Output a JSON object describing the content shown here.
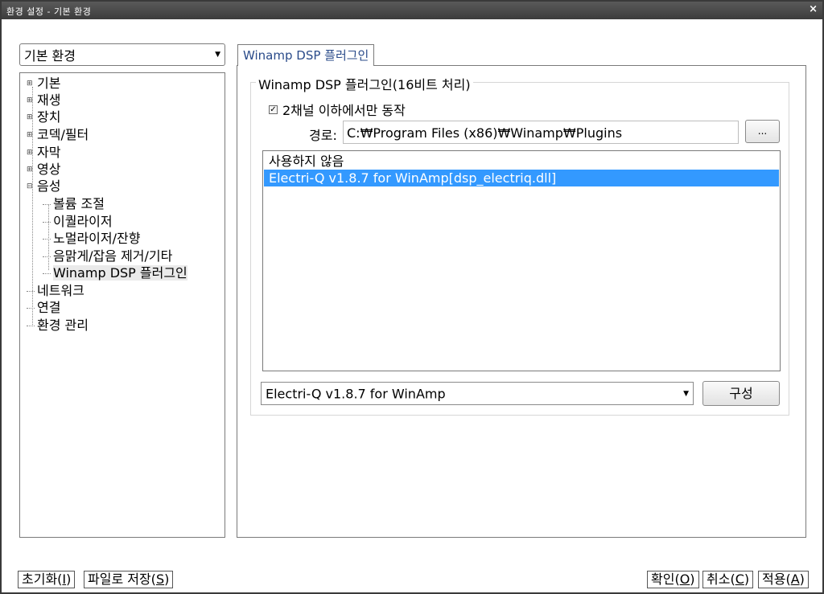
{
  "window": {
    "title": "환경 설정 - 기본 환경",
    "close_glyph": "×"
  },
  "category_combo": {
    "value": "기본 환경"
  },
  "tree": {
    "items": [
      {
        "label": "기본"
      },
      {
        "label": "재생"
      },
      {
        "label": "장치"
      },
      {
        "label": "코덱/필터"
      },
      {
        "label": "자막"
      },
      {
        "label": "영상"
      },
      {
        "label": "음성"
      },
      {
        "label": "볼륨 조절"
      },
      {
        "label": "이퀄라이저"
      },
      {
        "label": "노멀라이저/잔향"
      },
      {
        "label": "음맑게/잡음 제거/기타"
      },
      {
        "label": "Winamp DSP 플러그인"
      },
      {
        "label": "네트워크"
      },
      {
        "label": "연결"
      },
      {
        "label": "환경 관리"
      }
    ]
  },
  "tab": {
    "label": "Winamp DSP 플러그인"
  },
  "group": {
    "title": "Winamp DSP 플러그인(16비트 처리)",
    "checkbox_label": "2채널 이하에서만 동작",
    "checkbox_checked": true,
    "path_label": "경로:",
    "path_value": "C:₩Program Files (x86)₩Winamp₩Plugins",
    "browse_label": "...",
    "list": [
      {
        "label": "사용하지 않음"
      },
      {
        "label": "Electri-Q v1.8.7 for WinAmp[dsp_electriq.dll]"
      }
    ],
    "selected_index": 1,
    "plugin_combo_value": "Electri-Q v1.8.7 for WinAmp",
    "config_label": "구성"
  },
  "buttons": {
    "reset": {
      "text": "초기화(",
      "key": "I",
      "end": ")"
    },
    "save_file": {
      "text": "파일로 저장(",
      "key": "S",
      "end": ")"
    },
    "ok": {
      "text": "확인(",
      "key": "O",
      "end": ")"
    },
    "cancel": {
      "text": "취소(",
      "key": "C",
      "end": ")"
    },
    "apply": {
      "text": "적용(",
      "key": "A",
      "end": ")"
    }
  },
  "colors": {
    "selection": "#3399ff",
    "tab_text": "#2a4b8a"
  }
}
